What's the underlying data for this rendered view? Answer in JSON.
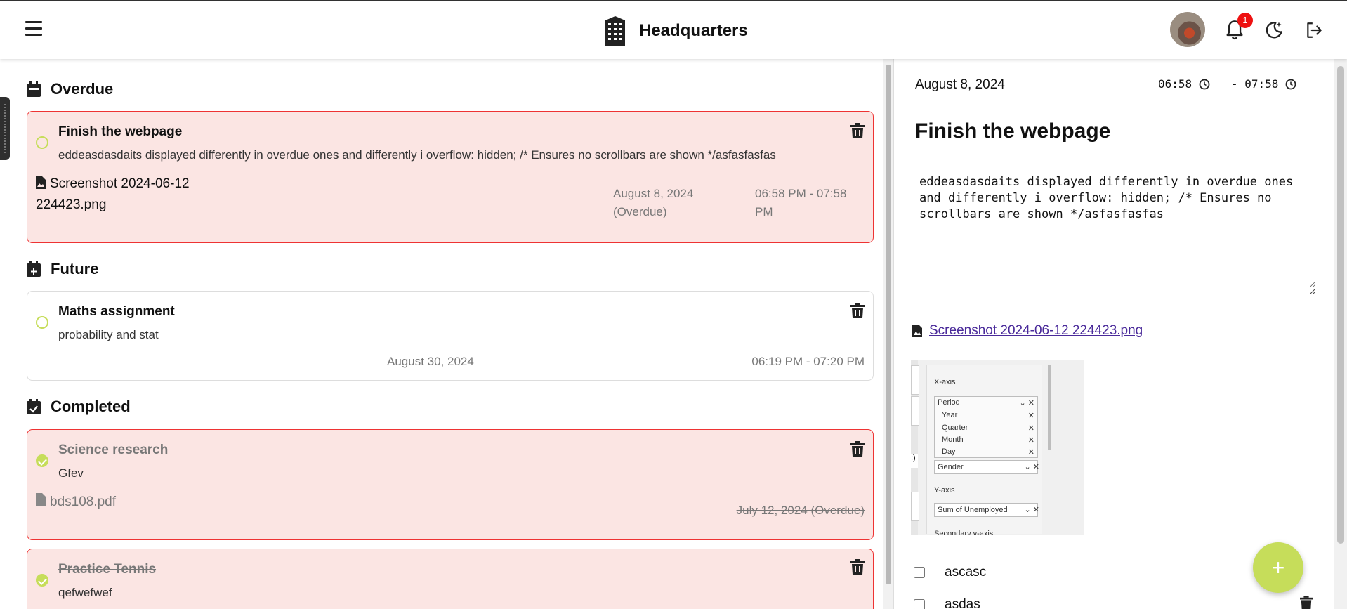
{
  "header": {
    "title": "Headquarters",
    "notification_count": "1"
  },
  "sections": {
    "overdue": "Overdue",
    "future": "Future",
    "completed": "Completed"
  },
  "tasks": [
    {
      "title": "Finish the webpage",
      "description": "eddeasdasdaits displayed differently in overdue ones and differently i overflow: hidden; /* Ensures no scrollbars are shown */asfasfasfas",
      "attachment_line1": "Screenshot 2024-06-12",
      "attachment_line2": "224423.png",
      "date_line1": "August 8, 2024",
      "date_line2": "(Overdue)",
      "time_line1": "06:58 PM - 07:58",
      "time_line2": "PM"
    },
    {
      "title": "Maths assignment",
      "description": "probability and stat",
      "date": "August 30, 2024",
      "time": "06:19 PM - 07:20 PM"
    },
    {
      "title": "Science research",
      "description": "Gfev",
      "attachment": "bds108.pdf",
      "date": "July 12, 2024 (Overdue)"
    },
    {
      "title": "Practice Tennis",
      "description": "qefwefwef"
    }
  ],
  "detail": {
    "date": "August 8, 2024",
    "start_time": "06:58",
    "end_time": "- 07:58",
    "title": "Finish the webpage",
    "description": "eddeasdasdaits displayed differently in overdue ones and differently i overflow: hidden; /* Ensures no scrollbars are shown */asfasfasfas",
    "attachment": "Screenshot 2024-06-12 224423.png",
    "preview": {
      "x_axis": "X-axis",
      "period": "Period",
      "year": "Year",
      "quarter": "Quarter",
      "month": "Month",
      "day": "Day",
      "gender": "Gender",
      "y_axis": "Y-axis",
      "sum": "Sum of Unemployed",
      "secondary": "Secondary y-axis"
    },
    "subtasks": [
      "ascasc",
      "asdas"
    ]
  },
  "fab_label": "+",
  "colors": {
    "accent": "#c6dd5a",
    "overdue_bg": "#fbe5e3",
    "overdue_border": "#ee3333",
    "badge": "#ee1111"
  }
}
